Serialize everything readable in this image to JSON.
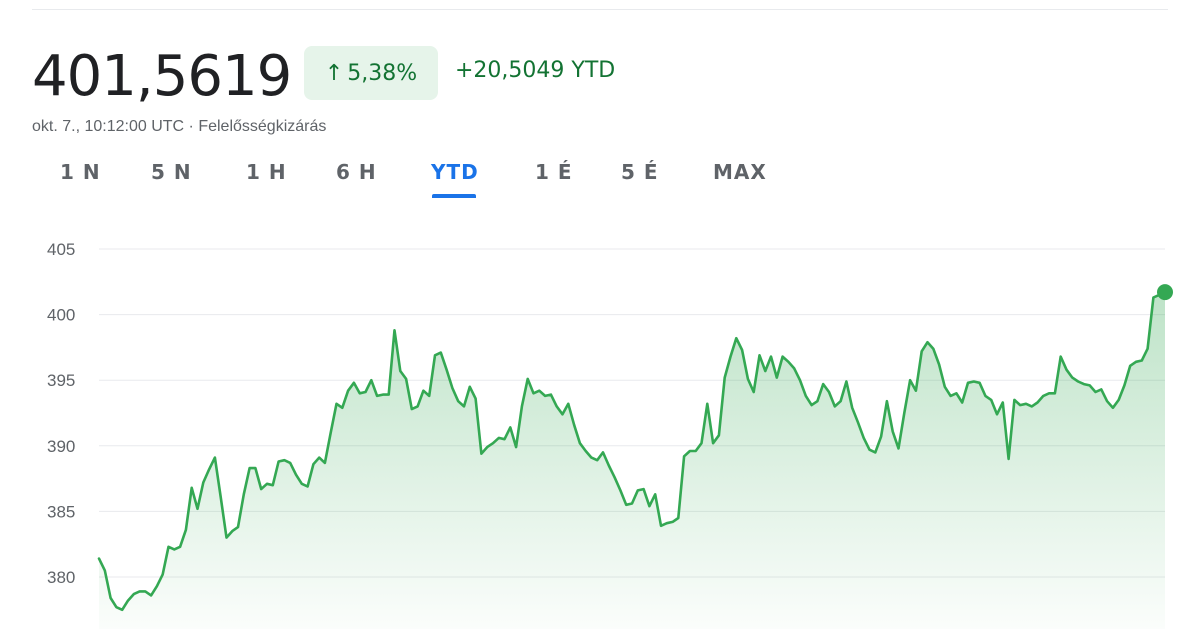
{
  "header": {
    "price": "401,5619",
    "change_arrow": "↑",
    "change_pct": "5,38%",
    "change_abs": "+20,5049 YTD",
    "timestamp": "okt. 7., 10:12:00 UTC",
    "separator": "·",
    "disclaimer": "Felelősségkizárás"
  },
  "tabs": [
    {
      "label": "1 N",
      "active": false
    },
    {
      "label": "5 N",
      "active": false
    },
    {
      "label": "1 H",
      "active": false
    },
    {
      "label": "6 H",
      "active": false
    },
    {
      "label": "YTD",
      "active": true
    },
    {
      "label": "1 É",
      "active": false
    },
    {
      "label": "5 É",
      "active": false
    },
    {
      "label": "MAX",
      "active": false
    }
  ],
  "colors": {
    "positive": "#137333",
    "line": "#34a853",
    "badge_bg": "#e6f4ea",
    "active_tab": "#1a73e8",
    "grid": "#e8eaed"
  },
  "chart_data": {
    "type": "area",
    "title": "",
    "xlabel": "",
    "ylabel": "",
    "ylim": [
      376.5,
      405
    ],
    "yticks": [
      405,
      400,
      395,
      390,
      385,
      380
    ],
    "grid": true,
    "legend": "none",
    "series": [
      {
        "values": [
          381.4,
          380.5,
          378.4,
          377.7,
          377.5,
          378.2,
          378.7,
          378.9,
          378.9,
          378.6,
          379.3,
          380.2,
          382.3,
          382.1,
          382.3,
          383.6,
          386.8,
          385.2,
          387.2,
          388.2,
          389.1,
          386.1,
          383.0,
          383.5,
          383.8,
          386.3,
          388.3,
          388.3,
          386.7,
          387.1,
          387.0,
          388.8,
          388.9,
          388.7,
          387.8,
          387.1,
          386.9,
          388.6,
          389.1,
          388.7,
          391.0,
          393.2,
          392.9,
          394.2,
          394.8,
          394.0,
          394.1,
          395.0,
          393.8,
          393.9,
          393.9,
          398.8,
          395.7,
          395.1,
          392.8,
          393.0,
          394.2,
          393.8,
          396.9,
          397.1,
          395.8,
          394.4,
          393.4,
          393.0,
          394.5,
          393.6,
          389.4,
          389.9,
          390.2,
          390.6,
          390.5,
          391.4,
          389.9,
          393.0,
          395.1,
          394.0,
          394.2,
          393.8,
          393.9,
          393.0,
          392.4,
          393.2,
          391.6,
          390.2,
          389.6,
          389.1,
          388.9,
          389.5,
          388.5,
          387.6,
          386.6,
          385.5,
          385.6,
          386.6,
          386.7,
          385.4,
          386.3,
          383.9,
          384.1,
          384.2,
          384.5,
          389.2,
          389.6,
          389.6,
          390.2,
          393.2,
          390.2,
          390.8,
          395.2,
          396.8,
          398.2,
          397.3,
          395.1,
          394.1,
          396.9,
          395.7,
          396.8,
          395.2,
          396.8,
          396.4,
          395.9,
          395.0,
          393.8,
          393.1,
          393.4,
          394.7,
          394.1,
          393.0,
          393.4,
          394.9,
          392.9,
          391.8,
          390.6,
          389.7,
          389.5,
          390.7,
          393.4,
          391.1,
          389.8,
          392.5,
          395.0,
          394.2,
          397.2,
          397.9,
          397.4,
          396.2,
          394.5,
          393.8,
          394.0,
          393.3,
          394.8,
          394.9,
          394.8,
          393.8,
          393.5,
          392.4,
          393.3,
          389.0,
          393.5,
          393.1,
          393.2,
          393.0,
          393.3,
          393.8,
          394.0,
          394.0,
          396.8,
          395.8,
          395.2,
          394.9,
          394.7,
          394.6,
          394.1,
          394.3,
          393.4,
          392.9,
          393.5,
          394.6,
          396.1,
          396.4,
          396.5,
          397.4,
          401.3,
          401.5,
          401.6
        ]
      }
    ],
    "last_value": 401.5619
  }
}
